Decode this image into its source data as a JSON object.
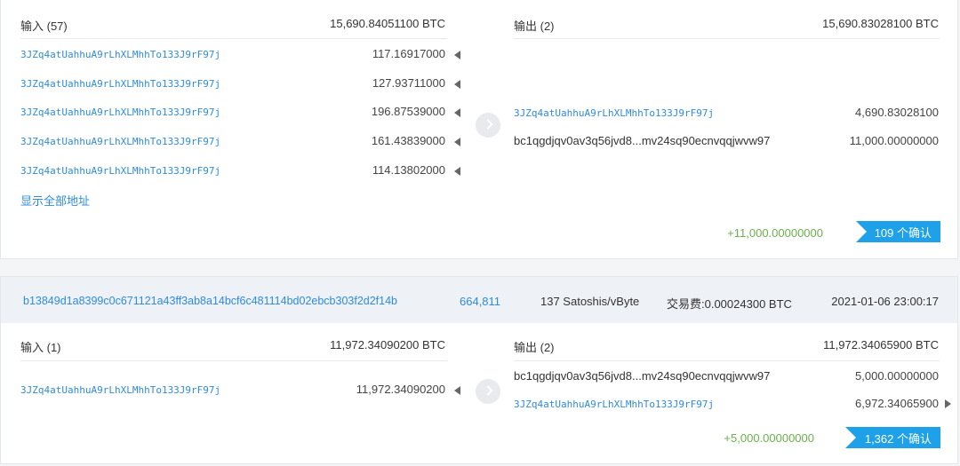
{
  "tx1": {
    "inputs_header": "输入 (57)",
    "inputs_total": "15,690.84051100 BTC",
    "outputs_header": "输出 (2)",
    "outputs_total": "15,690.83028100 BTC",
    "inputs": [
      {
        "address": "3JZq4atUahhuA9rLhXLMhhTo133J9rF97j",
        "amount": "117.16917000"
      },
      {
        "address": "3JZq4atUahhuA9rLhXLMhhTo133J9rF97j",
        "amount": "127.93711000"
      },
      {
        "address": "3JZq4atUahhuA9rLhXLMhhTo133J9rF97j",
        "amount": "196.87539000"
      },
      {
        "address": "3JZq4atUahhuA9rLhXLMhhTo133J9rF97j",
        "amount": "161.43839000"
      },
      {
        "address": "3JZq4atUahhuA9rLhXLMhhTo133J9rF97j",
        "amount": "114.13802000"
      }
    ],
    "show_all": "显示全部地址",
    "outputs": [
      {
        "address": "3JZq4atUahhuA9rLhXLMhhTo133J9rF97j",
        "amount": "4,690.83028100"
      },
      {
        "address": "bc1qgdjqv0av3q56jvd8...mv24sq90ecnvqqjwvw97",
        "amount": "11,000.00000000"
      }
    ],
    "delta": "+11,000.00000000",
    "confirmations": "109 个确认"
  },
  "tx2": {
    "hash": "b13849d1a8399c0c671121a43ff3ab8a14bcf6c481114bd02ebcb303f2d2f14b",
    "block": "664,811",
    "fee_rate": "137 Satoshis/vByte",
    "fee": "交易费:0.00024300 BTC",
    "time": "2021-01-06 23:00:17",
    "inputs_header": "输入 (1)",
    "inputs_total": "11,972.34090200 BTC",
    "outputs_header": "输出 (2)",
    "outputs_total": "11,972.34065900 BTC",
    "inputs": [
      {
        "address": "3JZq4atUahhuA9rLhXLMhhTo133J9rF97j",
        "amount": "11,972.34090200"
      }
    ],
    "outputs": [
      {
        "address": "bc1qgdjqv0av3q56jvd8...mv24sq90ecnvqqjwvw97",
        "amount": "5,000.00000000"
      },
      {
        "address": "3JZq4atUahhuA9rLhXLMhhTo133J9rF97j",
        "amount": "6,972.34065900"
      }
    ],
    "delta": "+5,000.00000000",
    "confirmations": "1,362 个确认"
  }
}
